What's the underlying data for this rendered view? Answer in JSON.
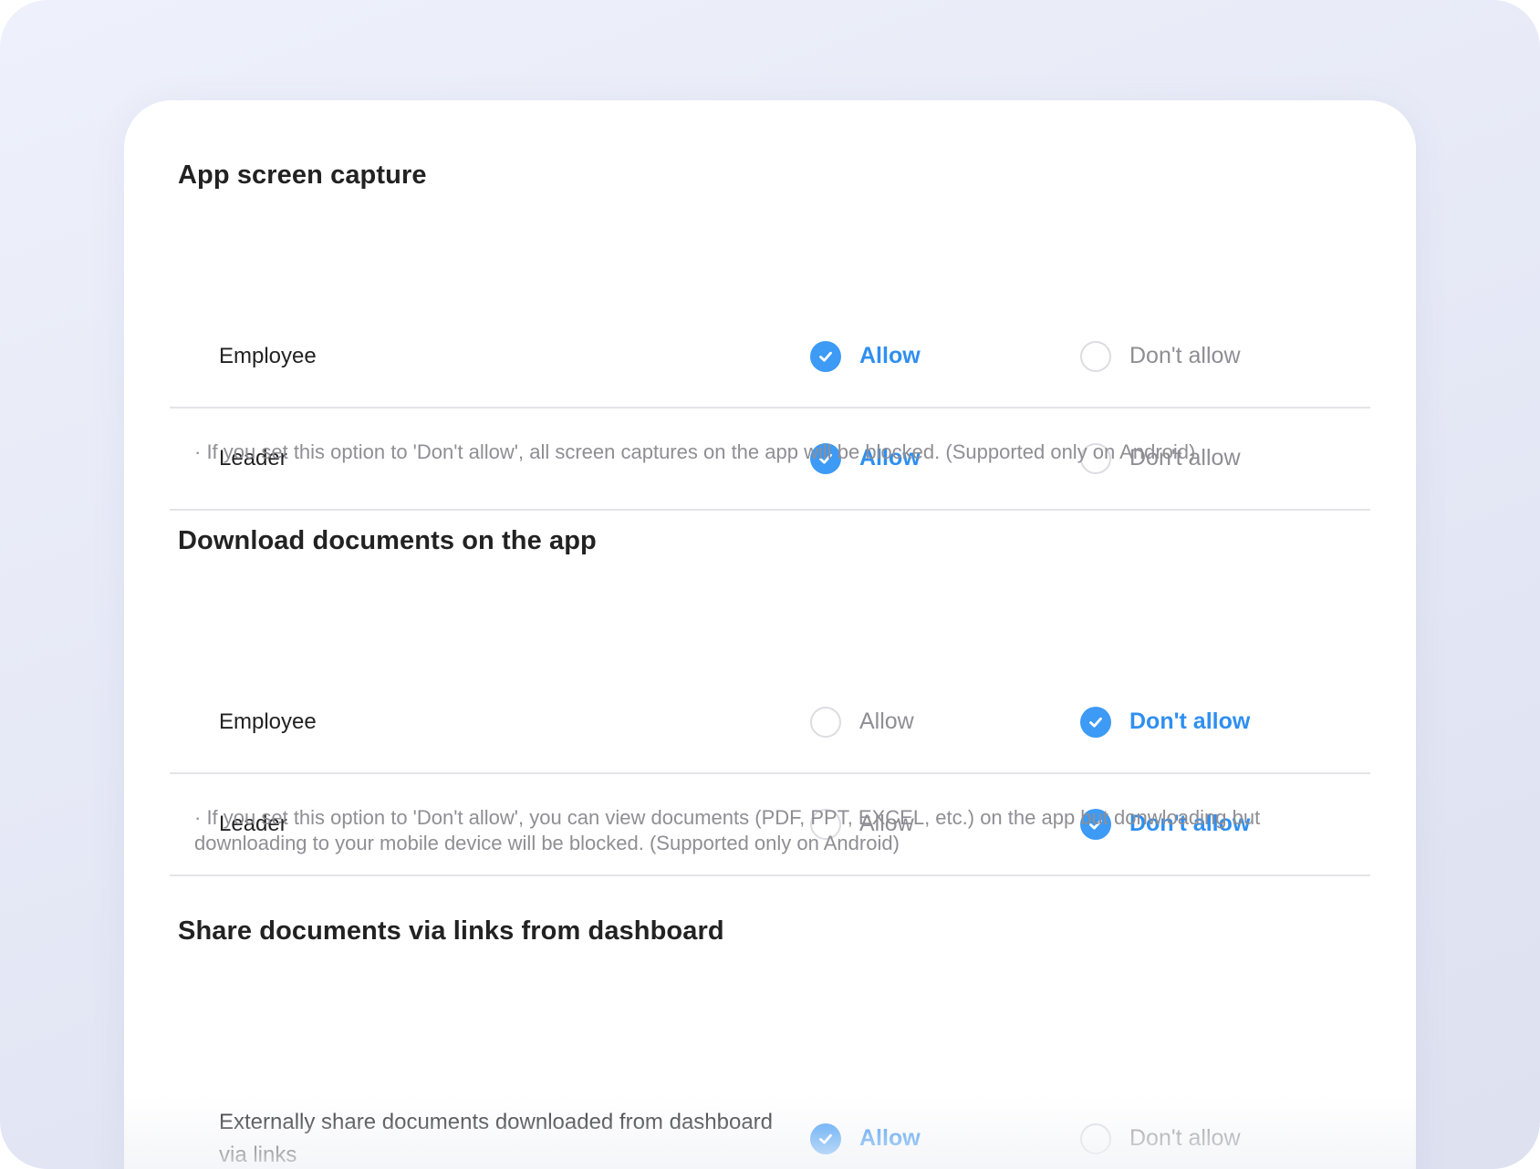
{
  "sections": [
    {
      "title": "App screen capture",
      "rows": [
        {
          "label": "Employee",
          "allow": "Allow",
          "deny": "Don't allow",
          "selected": "allow"
        },
        {
          "label": "Leader",
          "allow": "Allow",
          "deny": "Don't allow",
          "selected": "allow"
        }
      ],
      "note": "· If you set this option to 'Don't allow', all screen captures on the app will be blocked. (Supported only on Android)"
    },
    {
      "title": "Download documents on the app",
      "rows": [
        {
          "label": "Employee",
          "allow": "Allow",
          "deny": "Don't allow",
          "selected": "deny"
        },
        {
          "label": "Leader",
          "allow": "Allow",
          "deny": "Don't allow",
          "selected": "deny"
        }
      ],
      "note": "· If you set this option to 'Don't allow', you can view documents (PDF, PPT, EXCEL, etc.) on the app but donwloading but downloading to your mobile device will be blocked. (Supported only on Android)"
    },
    {
      "title": "Share documents via links from dashboard",
      "rows": [
        {
          "label": "Externally share documents downloaded from dashboard via links",
          "allow": "Allow",
          "deny": "Don't allow",
          "selected": "allow"
        }
      ]
    }
  ],
  "colors": {
    "accent": "#3d9af5",
    "selected_text": "#2f8ff0",
    "muted_text": "#8e8e94",
    "divider": "#e4e4e8"
  },
  "icons": {
    "selected": "check-circle-icon",
    "unselected": "empty-circle-icon"
  }
}
